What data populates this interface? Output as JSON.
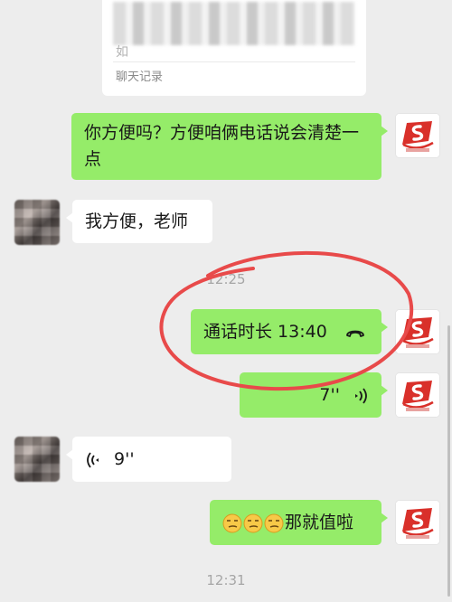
{
  "record_card": {
    "preview_stub": "如",
    "footer_label": "聊天记录"
  },
  "messages": [
    {
      "side": "right",
      "kind": "text",
      "text": "你方便吗？方便咱俩电话说会清楚一点"
    },
    {
      "side": "left",
      "kind": "text",
      "text": "我方便，老师"
    },
    {
      "kind": "timestamp",
      "text": "12:25"
    },
    {
      "side": "right",
      "kind": "call",
      "text": "通话时长 13:40"
    },
    {
      "side": "right",
      "kind": "voice",
      "text": "7''"
    },
    {
      "side": "left",
      "kind": "voice",
      "text": "9''"
    },
    {
      "side": "right",
      "kind": "text",
      "text": "那就值啦",
      "emoji_count": 3
    },
    {
      "kind": "timestamp",
      "text": "12:31"
    }
  ],
  "colors": {
    "background": "#ededed",
    "my_bubble": "#95ec69",
    "their_bubble": "#ffffff",
    "annotation_circle": "#e84a4a",
    "avatar_logo_red": "#d9302a"
  },
  "icons": {
    "call": "phone-handset-icon",
    "voice_right": "voice-wave-right-icon",
    "voice_left": "voice-wave-left-icon",
    "emoji": "smirk-emoji-icon"
  }
}
